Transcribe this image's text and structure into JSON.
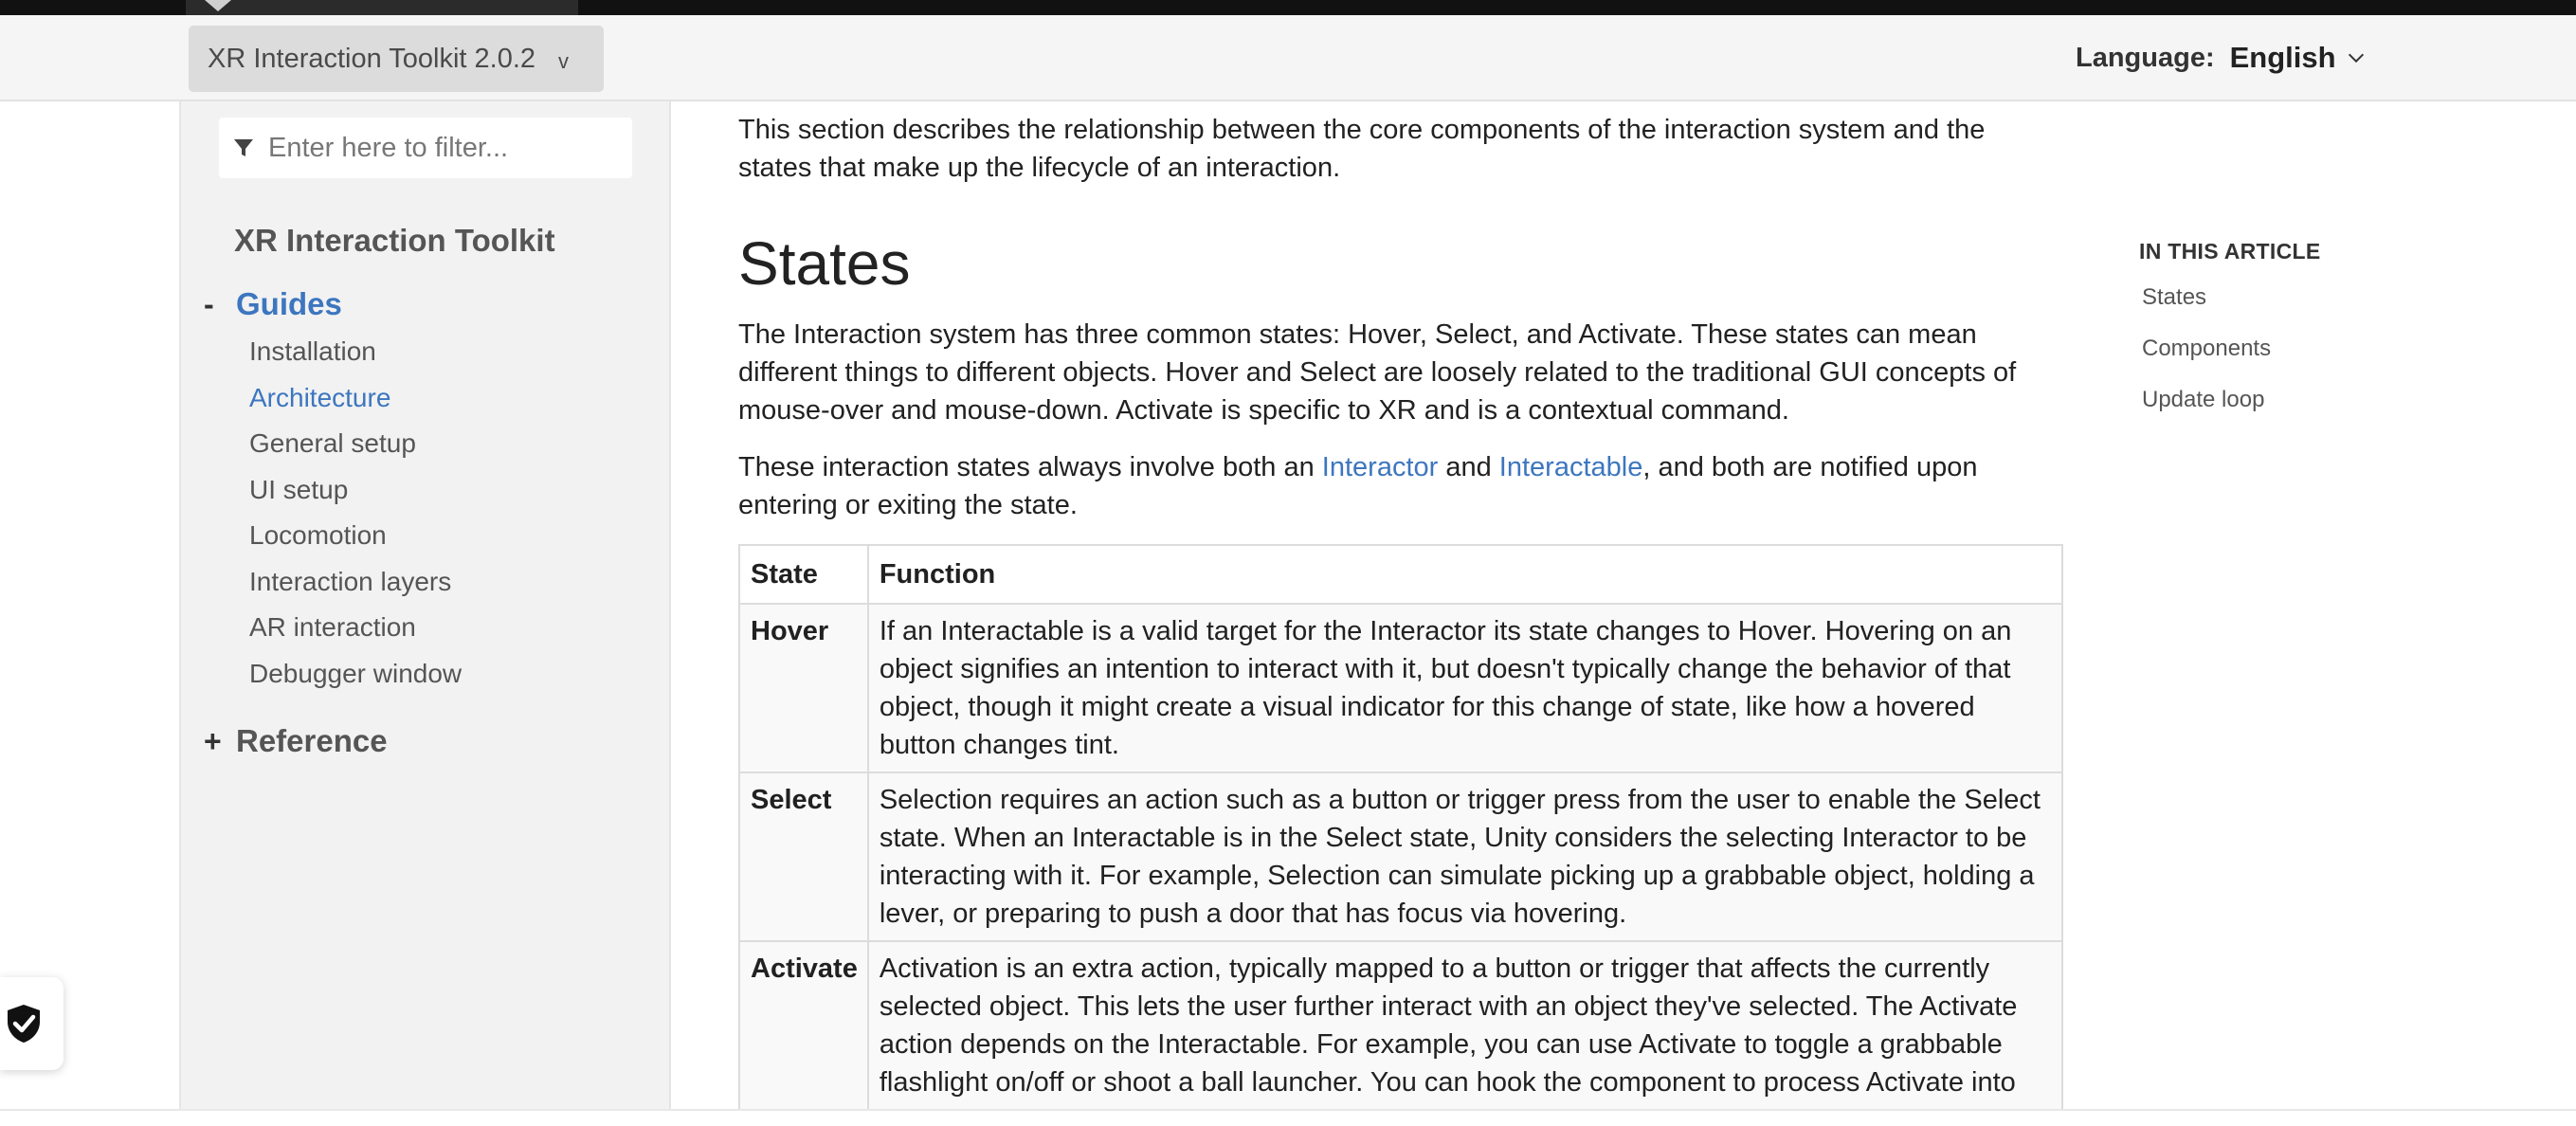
{
  "header": {
    "version_label": "XR Interaction Toolkit 2.0.2",
    "version_caret": "v",
    "language_label": "Language:",
    "language_value": "English"
  },
  "sidebar": {
    "filter_placeholder": "Enter here to filter...",
    "toc_title": "XR Interaction Toolkit",
    "groups": [
      {
        "sign": "-",
        "label": "Guides",
        "expanded": true
      },
      {
        "sign": "+",
        "label": "Reference",
        "expanded": false
      }
    ],
    "items": [
      {
        "label": "Installation"
      },
      {
        "label": "Architecture",
        "active": true
      },
      {
        "label": "General setup"
      },
      {
        "label": "UI setup"
      },
      {
        "label": "Locomotion"
      },
      {
        "label": "Interaction layers"
      },
      {
        "label": "AR interaction"
      },
      {
        "label": "Debugger window"
      }
    ]
  },
  "main": {
    "intro": "This section describes the relationship between the core components of the interaction system and the states that make up the lifecycle of an interaction.",
    "heading": "States",
    "para1": "The Interaction system has three common states: Hover, Select, and Activate. These states can mean different things to different objects. Hover and Select are loosely related to the traditional GUI concepts of mouse-over and mouse-down. Activate is specific to XR and is a contextual command.",
    "para2": {
      "before": "These interaction states always involve both an ",
      "link1": "Interactor",
      "middle": " and ",
      "link2": "Interactable",
      "after": ", and both are notified upon entering or exiting the state."
    },
    "table": {
      "headers": [
        "State",
        "Function"
      ],
      "rows": [
        {
          "state": "Hover",
          "function": "If an Interactable is a valid target for the Interactor its state changes to Hover. Hovering on an object signifies an intention to interact with it, but doesn't typically change the behavior of that object, though it might create a visual indicator for this change of state, like how a hovered button changes tint."
        },
        {
          "state": "Select",
          "function": "Selection requires an action such as a button or trigger press from the user to enable the Select state. When an Interactable is in the Select state, Unity considers the selecting Interactor to be interacting with it. For example, Selection can simulate picking up a grabbable object, holding a lever, or preparing to push a door that has focus via hovering."
        },
        {
          "state": "Activate",
          "function": "Activation is an extra action, typically mapped to a button or trigger that affects the currently selected object. This lets the user further interact with an object they've selected. The Activate action depends on the Interactable. For example, you can use Activate to toggle a grabbable flashlight on/off or shoot a ball launcher. You can hook the component to process Activate into an action"
        }
      ]
    }
  },
  "article_toc": {
    "title": "IN THIS ARTICLE",
    "items": [
      "States",
      "Components",
      "Update loop"
    ]
  },
  "colors": {
    "link": "#3d76bf",
    "sidebar_bg": "#f2f2f2",
    "header_bg": "#f5f5f5",
    "topbar": "#111111"
  }
}
